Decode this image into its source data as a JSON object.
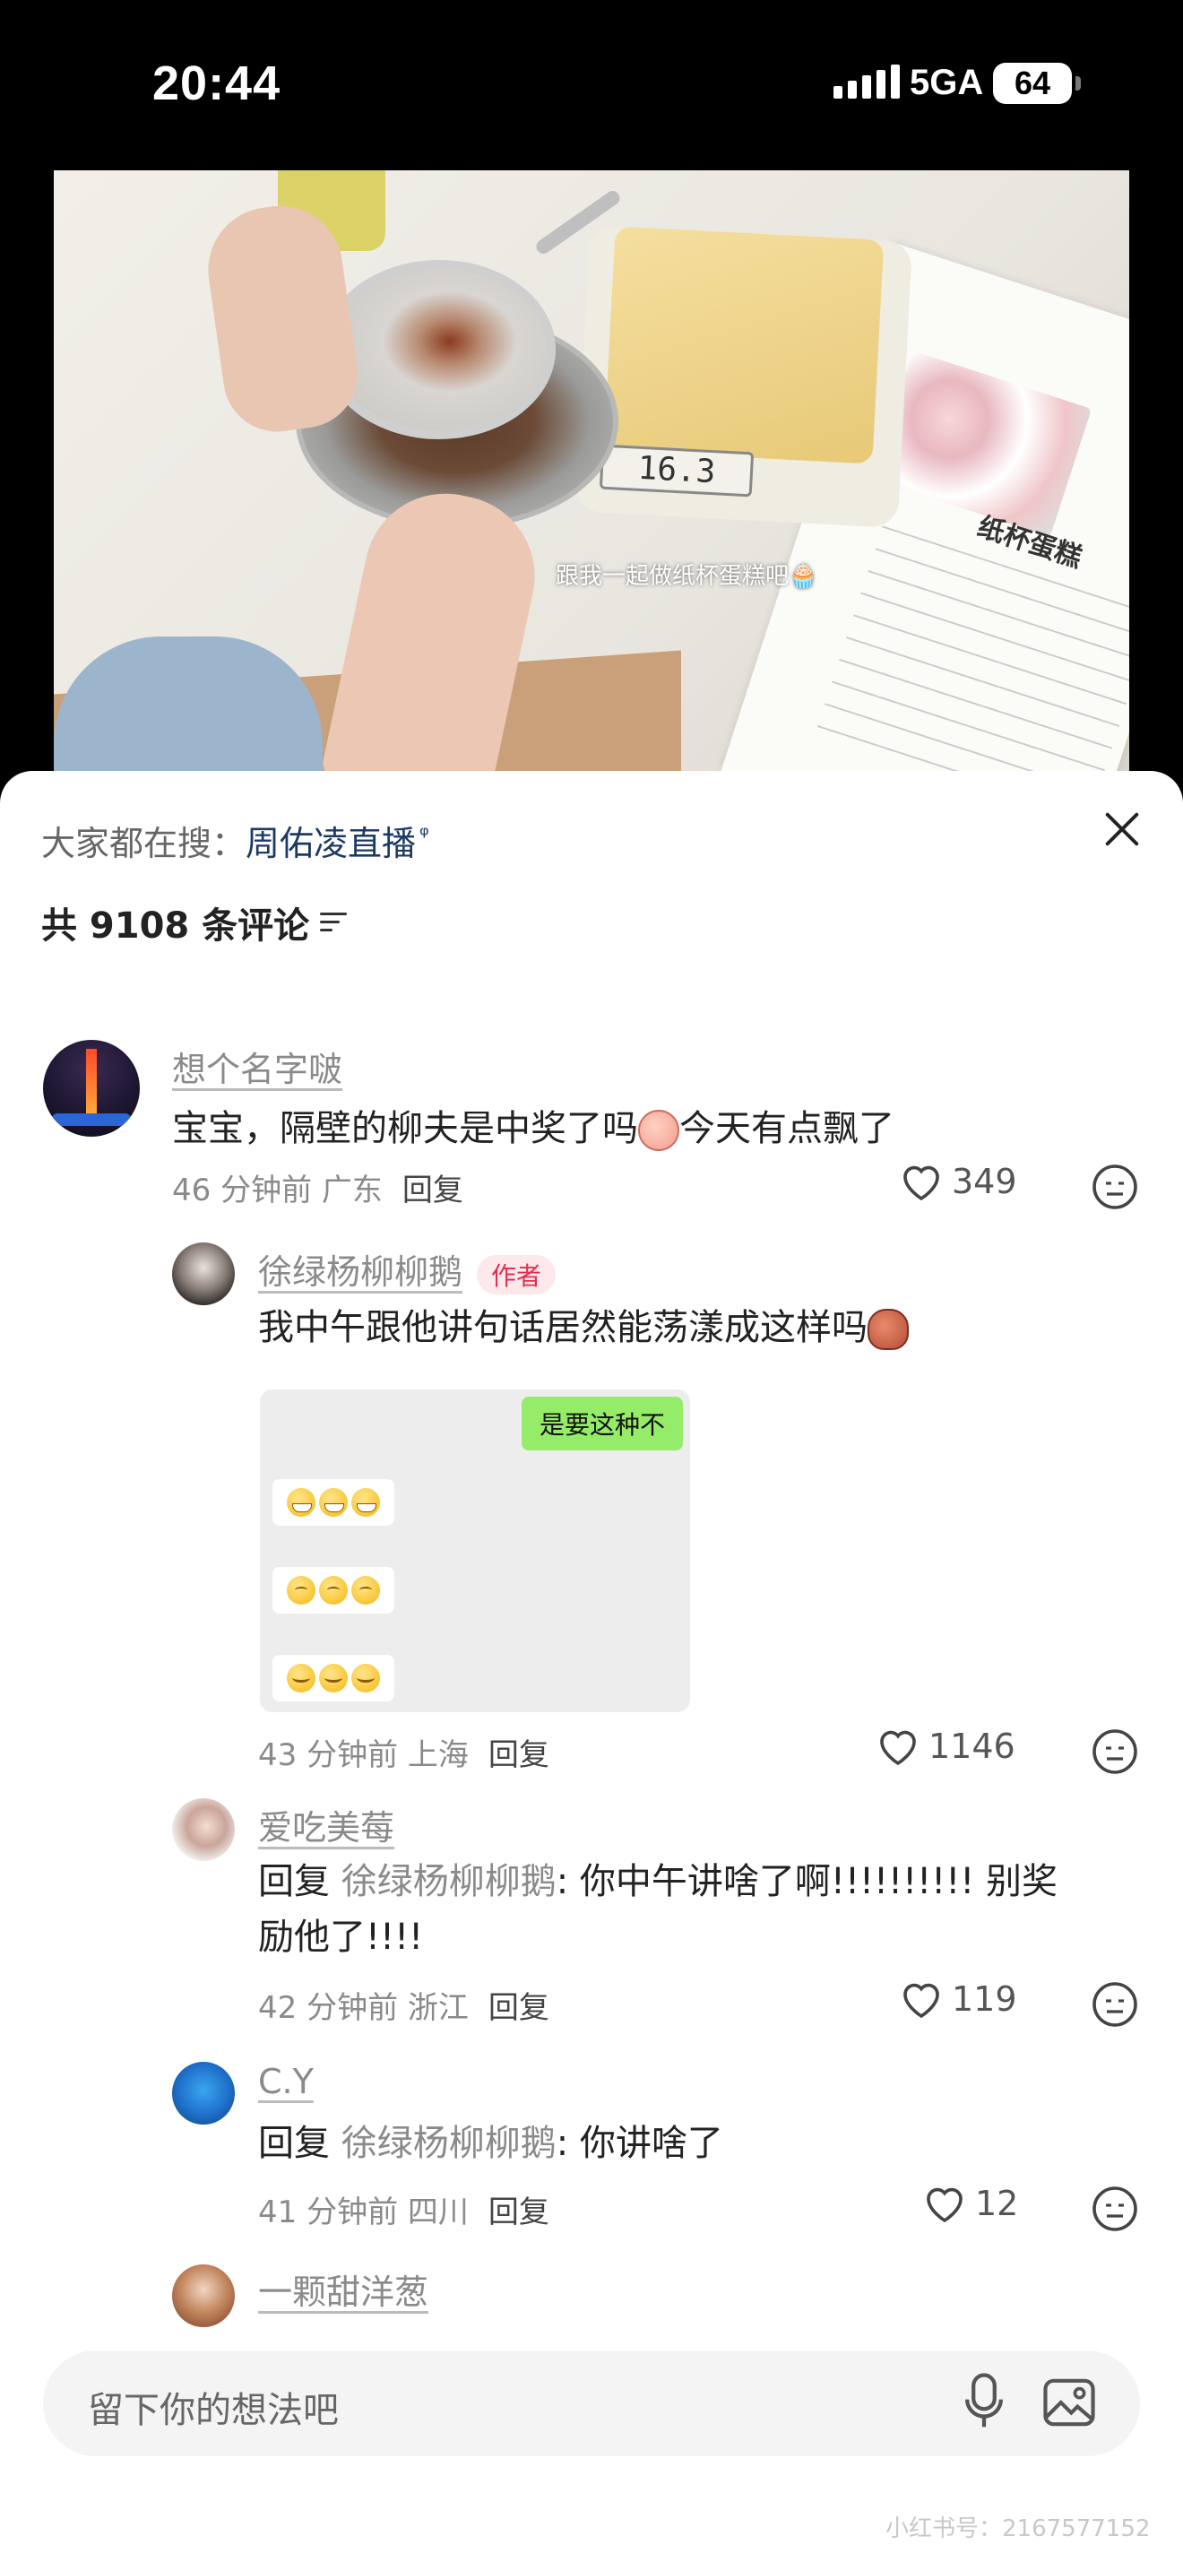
{
  "status_bar": {
    "time": "20:44",
    "network": "5GA",
    "battery": "64"
  },
  "video": {
    "caption": "跟我一起做纸杯蛋糕吧🧁",
    "scale_reading": "16.3",
    "recipe_title": "纸杯蛋糕"
  },
  "sheet": {
    "search_prefix": "大家都在搜：",
    "search_term": "周佑凌直播",
    "comment_count": "共 9108 条评论"
  },
  "comments": [
    {
      "username": "想个名字啵",
      "text_before": "宝宝，隔壁的柳夫是中奖了吗",
      "text_after": "今天有点飘了",
      "time": "46 分钟前",
      "location": "广东",
      "reply_label": "回复",
      "likes": "349"
    },
    {
      "username": "徐绿杨柳柳鹅",
      "badge": "作者",
      "text": "我中午跟他讲句话居然能荡漾成这样吗",
      "chat_bubble": "是要这种不",
      "time": "43 分钟前",
      "location": "上海",
      "reply_label": "回复",
      "likes": "1146"
    },
    {
      "username": "爱吃美莓",
      "reply_prefix": "回复 ",
      "reply_to": "徐绿杨柳柳鹅",
      "text_line1": ": 你中午讲啥了啊!!!!!!!!!! 别奖",
      "text_line2": "励他了!!!!",
      "time": "42 分钟前",
      "location": "浙江",
      "reply_label": "回复",
      "likes": "119"
    },
    {
      "username": "C.Y",
      "reply_prefix": "回复 ",
      "reply_to": "徐绿杨柳柳鹅",
      "text": ": 你讲啥了",
      "time": "41 分钟前",
      "location": "四川",
      "reply_label": "回复",
      "likes": "12"
    },
    {
      "username": "一颗甜洋葱"
    }
  ],
  "input": {
    "placeholder": "留下你的想法吧"
  },
  "watermark": "小红书号：2167577152",
  "colors": {
    "link": "#1d3a66",
    "author_badge": "#e0304e",
    "chat_green": "#95ec69"
  }
}
